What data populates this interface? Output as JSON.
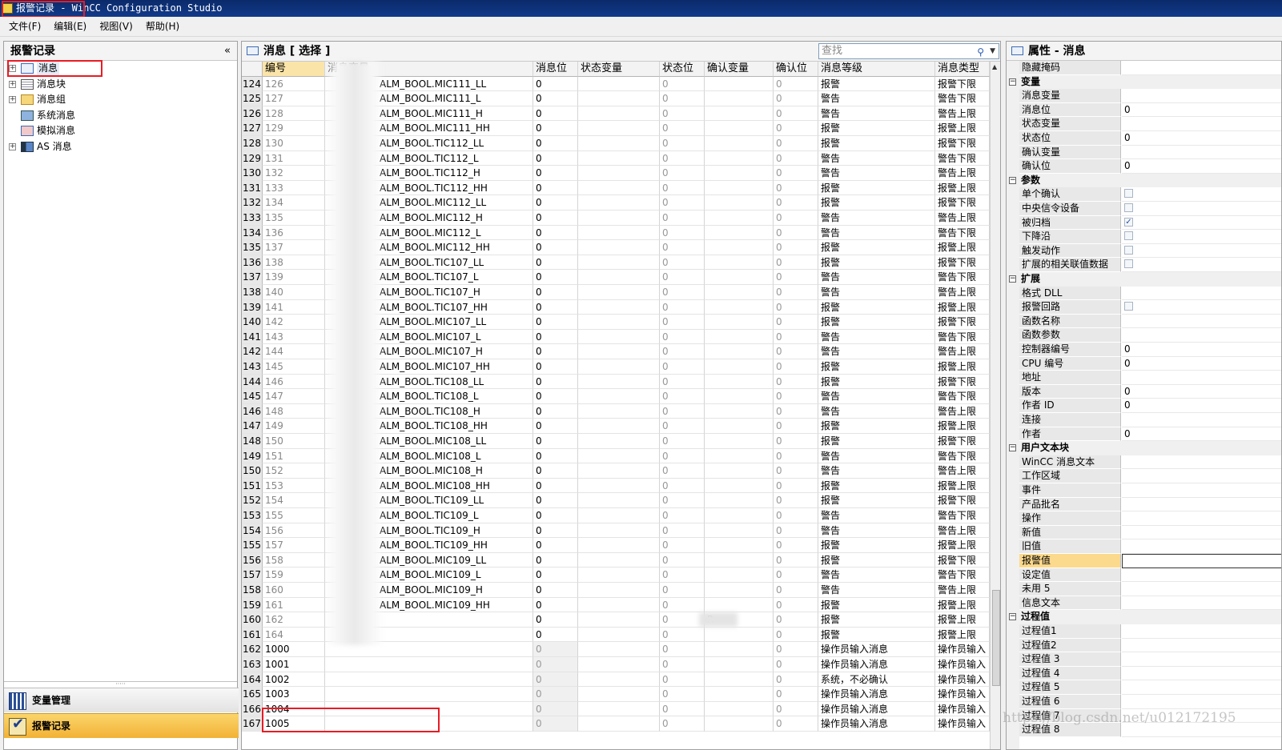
{
  "window": {
    "title": "报警记录 - WinCC Configuration Studio"
  },
  "menu": [
    "文件(F)",
    "编辑(E)",
    "视图(V)",
    "帮助(H)"
  ],
  "left": {
    "title": "报警记录",
    "collapse_glyph": "«",
    "tree": [
      {
        "label": "消息",
        "expandable": true,
        "icon": "envelope-icon"
      },
      {
        "label": "消息块",
        "expandable": true,
        "icon": "document-icon"
      },
      {
        "label": "消息组",
        "expandable": true,
        "icon": "folder-icon"
      },
      {
        "label": "系统消息",
        "expandable": false,
        "icon": "computer-icon"
      },
      {
        "label": "模拟消息",
        "expandable": false,
        "icon": "simulate-icon"
      },
      {
        "label": "AS 消息",
        "expandable": true,
        "icon": "plc-icon"
      }
    ],
    "nav": [
      {
        "label": "变量管理",
        "icon": "tag-management-icon"
      },
      {
        "label": "报警记录",
        "icon": "alarm-logging-icon"
      }
    ]
  },
  "middle": {
    "title": "消息 [ 选择 ]",
    "search_placeholder": "查找",
    "columns": [
      "编号",
      "消息变量",
      "消息位",
      "状态变量",
      "状态位",
      "确认变量",
      "确认位",
      "消息等级",
      "消息类型"
    ],
    "rows": [
      [
        "124",
        "126",
        "ALM_BOOL.MIC111_LL",
        "0",
        "",
        "0",
        "",
        "0",
        "报警",
        "报警下限"
      ],
      [
        "125",
        "127",
        "ALM_BOOL.MIC111_L",
        "0",
        "",
        "0",
        "",
        "0",
        "警告",
        "警告下限"
      ],
      [
        "126",
        "128",
        "ALM_BOOL.MIC111_H",
        "0",
        "",
        "0",
        "",
        "0",
        "警告",
        "警告上限"
      ],
      [
        "127",
        "129",
        "ALM_BOOL.MIC111_HH",
        "0",
        "",
        "0",
        "",
        "0",
        "报警",
        "报警上限"
      ],
      [
        "128",
        "130",
        "ALM_BOOL.TIC112_LL",
        "0",
        "",
        "0",
        "",
        "0",
        "报警",
        "报警下限"
      ],
      [
        "129",
        "131",
        "ALM_BOOL.TIC112_L",
        "0",
        "",
        "0",
        "",
        "0",
        "警告",
        "警告下限"
      ],
      [
        "130",
        "132",
        "ALM_BOOL.TIC112_H",
        "0",
        "",
        "0",
        "",
        "0",
        "警告",
        "警告上限"
      ],
      [
        "131",
        "133",
        "ALM_BOOL.TIC112_HH",
        "0",
        "",
        "0",
        "",
        "0",
        "报警",
        "报警上限"
      ],
      [
        "132",
        "134",
        "ALM_BOOL.MIC112_LL",
        "0",
        "",
        "0",
        "",
        "0",
        "报警",
        "报警下限"
      ],
      [
        "133",
        "135",
        "ALM_BOOL.MIC112_H",
        "0",
        "",
        "0",
        "",
        "0",
        "警告",
        "警告上限"
      ],
      [
        "134",
        "136",
        "ALM_BOOL.MIC112_L",
        "0",
        "",
        "0",
        "",
        "0",
        "警告",
        "警告下限"
      ],
      [
        "135",
        "137",
        "ALM_BOOL.MIC112_HH",
        "0",
        "",
        "0",
        "",
        "0",
        "报警",
        "报警上限"
      ],
      [
        "136",
        "138",
        "ALM_BOOL.TIC107_LL",
        "0",
        "",
        "0",
        "",
        "0",
        "报警",
        "报警下限"
      ],
      [
        "137",
        "139",
        "ALM_BOOL.TIC107_L",
        "0",
        "",
        "0",
        "",
        "0",
        "警告",
        "警告下限"
      ],
      [
        "138",
        "140",
        "ALM_BOOL.TIC107_H",
        "0",
        "",
        "0",
        "",
        "0",
        "警告",
        "警告上限"
      ],
      [
        "139",
        "141",
        "ALM_BOOL.TIC107_HH",
        "0",
        "",
        "0",
        "",
        "0",
        "报警",
        "报警上限"
      ],
      [
        "140",
        "142",
        "ALM_BOOL.MIC107_LL",
        "0",
        "",
        "0",
        "",
        "0",
        "报警",
        "报警下限"
      ],
      [
        "141",
        "143",
        "ALM_BOOL.MIC107_L",
        "0",
        "",
        "0",
        "",
        "0",
        "警告",
        "警告下限"
      ],
      [
        "142",
        "144",
        "ALM_BOOL.MIC107_H",
        "0",
        "",
        "0",
        "",
        "0",
        "警告",
        "警告上限"
      ],
      [
        "143",
        "145",
        "ALM_BOOL.MIC107_HH",
        "0",
        "",
        "0",
        "",
        "0",
        "报警",
        "报警上限"
      ],
      [
        "144",
        "146",
        "ALM_BOOL.TIC108_LL",
        "0",
        "",
        "0",
        "",
        "0",
        "报警",
        "报警下限"
      ],
      [
        "145",
        "147",
        "ALM_BOOL.TIC108_L",
        "0",
        "",
        "0",
        "",
        "0",
        "警告",
        "警告下限"
      ],
      [
        "146",
        "148",
        "ALM_BOOL.TIC108_H",
        "0",
        "",
        "0",
        "",
        "0",
        "警告",
        "警告上限"
      ],
      [
        "147",
        "149",
        "ALM_BOOL.TIC108_HH",
        "0",
        "",
        "0",
        "",
        "0",
        "报警",
        "报警上限"
      ],
      [
        "148",
        "150",
        "ALM_BOOL.MIC108_LL",
        "0",
        "",
        "0",
        "",
        "0",
        "报警",
        "报警下限"
      ],
      [
        "149",
        "151",
        "ALM_BOOL.MIC108_L",
        "0",
        "",
        "0",
        "",
        "0",
        "警告",
        "警告下限"
      ],
      [
        "150",
        "152",
        "ALM_BOOL.MIC108_H",
        "0",
        "",
        "0",
        "",
        "0",
        "警告",
        "警告上限"
      ],
      [
        "151",
        "153",
        "ALM_BOOL.MIC108_HH",
        "0",
        "",
        "0",
        "",
        "0",
        "报警",
        "报警上限"
      ],
      [
        "152",
        "154",
        "ALM_BOOL.TIC109_LL",
        "0",
        "",
        "0",
        "",
        "0",
        "报警",
        "报警下限"
      ],
      [
        "153",
        "155",
        "ALM_BOOL.TIC109_L",
        "0",
        "",
        "0",
        "",
        "0",
        "警告",
        "警告下限"
      ],
      [
        "154",
        "156",
        "ALM_BOOL.TIC109_H",
        "0",
        "",
        "0",
        "",
        "0",
        "警告",
        "警告上限"
      ],
      [
        "155",
        "157",
        "ALM_BOOL.TIC109_HH",
        "0",
        "",
        "0",
        "",
        "0",
        "报警",
        "报警上限"
      ],
      [
        "156",
        "158",
        "ALM_BOOL.MIC109_LL",
        "0",
        "",
        "0",
        "",
        "0",
        "报警",
        "报警下限"
      ],
      [
        "157",
        "159",
        "ALM_BOOL.MIC109_L",
        "0",
        "",
        "0",
        "",
        "0",
        "警告",
        "警告下限"
      ],
      [
        "158",
        "160",
        "ALM_BOOL.MIC109_H",
        "0",
        "",
        "0",
        "",
        "0",
        "警告",
        "警告上限"
      ],
      [
        "159",
        "161",
        "ALM_BOOL.MIC109_HH",
        "0",
        "",
        "0",
        "",
        "0",
        "报警",
        "报警上限"
      ],
      [
        "160",
        "162",
        "",
        "0",
        "",
        "0",
        "R",
        "0",
        "报警",
        "报警上限"
      ],
      [
        "161",
        "164",
        "",
        "0",
        "",
        "0",
        "",
        "0",
        "报警",
        "报警上限"
      ],
      [
        "162",
        "1000",
        "",
        "0",
        "",
        "0",
        "",
        "0",
        "操作员输入消息",
        "操作员输入"
      ],
      [
        "163",
        "1001",
        "",
        "0",
        "",
        "0",
        "",
        "0",
        "操作员输入消息",
        "操作员输入"
      ],
      [
        "164",
        "1002",
        "",
        "0",
        "",
        "0",
        "",
        "0",
        "系统，不必确认",
        "操作员输入"
      ],
      [
        "165",
        "1003",
        "",
        "0",
        "",
        "0",
        "",
        "0",
        "操作员输入消息",
        "操作员输入"
      ],
      [
        "166",
        "1004",
        "",
        "0",
        "",
        "0",
        "",
        "0",
        "操作员输入消息",
        "操作员输入"
      ],
      [
        "167",
        "1005",
        "",
        "0",
        "",
        "0",
        "",
        "0",
        "操作员输入消息",
        "操作员输入"
      ]
    ]
  },
  "right": {
    "title": "属性 - 消息",
    "items": [
      {
        "type": "prop",
        "k": "隐藏掩码",
        "v": ""
      },
      {
        "type": "cat",
        "k": "变量"
      },
      {
        "type": "prop",
        "k": "消息变量",
        "v": ""
      },
      {
        "type": "prop",
        "k": "消息位",
        "v": "0"
      },
      {
        "type": "prop",
        "k": "状态变量",
        "v": ""
      },
      {
        "type": "prop",
        "k": "状态位",
        "v": "0"
      },
      {
        "type": "prop",
        "k": "确认变量",
        "v": ""
      },
      {
        "type": "prop",
        "k": "确认位",
        "v": "0"
      },
      {
        "type": "cat",
        "k": "参数"
      },
      {
        "type": "check",
        "k": "单个确认",
        "v": false
      },
      {
        "type": "check",
        "k": "中央信令设备",
        "v": false
      },
      {
        "type": "check",
        "k": "被归档",
        "v": true
      },
      {
        "type": "check",
        "k": "下降沿",
        "v": false
      },
      {
        "type": "check",
        "k": "触发动作",
        "v": false
      },
      {
        "type": "check",
        "k": "扩展的相关联值数据",
        "v": false
      },
      {
        "type": "cat",
        "k": "扩展"
      },
      {
        "type": "prop",
        "k": "格式 DLL",
        "v": ""
      },
      {
        "type": "check",
        "k": "报警回路",
        "v": false
      },
      {
        "type": "prop",
        "k": "函数名称",
        "v": ""
      },
      {
        "type": "prop",
        "k": "函数参数",
        "v": ""
      },
      {
        "type": "prop",
        "k": "控制器编号",
        "v": "0"
      },
      {
        "type": "prop",
        "k": "CPU 编号",
        "v": "0"
      },
      {
        "type": "prop",
        "k": "地址",
        "v": ""
      },
      {
        "type": "prop",
        "k": "版本",
        "v": "0"
      },
      {
        "type": "prop",
        "k": "作者 ID",
        "v": "0"
      },
      {
        "type": "prop",
        "k": "连接",
        "v": ""
      },
      {
        "type": "prop",
        "k": "作者",
        "v": "0"
      },
      {
        "type": "cat",
        "k": "用户文本块"
      },
      {
        "type": "prop",
        "k": "WinCC 消息文本",
        "v": ""
      },
      {
        "type": "prop",
        "k": "工作区域",
        "v": ""
      },
      {
        "type": "prop",
        "k": "事件",
        "v": ""
      },
      {
        "type": "prop",
        "k": "产品批名",
        "v": ""
      },
      {
        "type": "prop",
        "k": "操作",
        "v": ""
      },
      {
        "type": "prop",
        "k": "新值",
        "v": ""
      },
      {
        "type": "prop",
        "k": "旧值",
        "v": ""
      },
      {
        "type": "prop",
        "k": "报警值",
        "v": "",
        "highlight": true
      },
      {
        "type": "prop",
        "k": "设定值",
        "v": ""
      },
      {
        "type": "prop",
        "k": "未用 5",
        "v": ""
      },
      {
        "type": "prop",
        "k": "信息文本",
        "v": ""
      },
      {
        "type": "cat",
        "k": "过程值"
      },
      {
        "type": "prop",
        "k": "过程值1",
        "v": ""
      },
      {
        "type": "prop",
        "k": "过程值2",
        "v": ""
      },
      {
        "type": "prop",
        "k": "过程值 3",
        "v": ""
      },
      {
        "type": "prop",
        "k": "过程值 4",
        "v": ""
      },
      {
        "type": "prop",
        "k": "过程值 5",
        "v": ""
      },
      {
        "type": "prop",
        "k": "过程值 6",
        "v": ""
      },
      {
        "type": "prop",
        "k": "过程值 7",
        "v": ""
      },
      {
        "type": "prop",
        "k": "过程值 8",
        "v": ""
      }
    ]
  },
  "watermark": "https://blog.csdn.net/u012172195",
  "colors": {
    "title_bar": "#0a2a6a",
    "selected_header": "#fbe4a8",
    "highlight": "#fbd98d",
    "annotation": "#e81c24",
    "nav_active": "#f7c04a"
  }
}
